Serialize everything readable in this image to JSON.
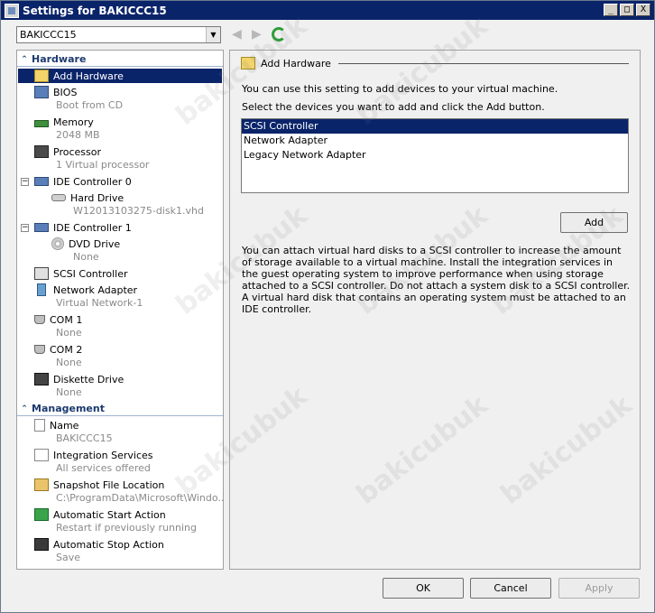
{
  "window": {
    "title": "Settings for BAKICCC15",
    "minimize": "_",
    "maximize": "□",
    "close": "X"
  },
  "vm_select": {
    "value": "BAKICCC15"
  },
  "left": {
    "hardware_header": "Hardware",
    "management_header": "Management",
    "items": {
      "add_hardware": "Add Hardware",
      "bios": "BIOS",
      "bios_sub": "Boot from CD",
      "memory": "Memory",
      "memory_sub": "2048 MB",
      "processor": "Processor",
      "processor_sub": "1 Virtual processor",
      "ide0": "IDE Controller 0",
      "hard_drive": "Hard Drive",
      "hard_drive_sub": "W12013103275-disk1.vhd",
      "ide1": "IDE Controller 1",
      "dvd_drive": "DVD Drive",
      "dvd_drive_sub": "None",
      "scsi": "SCSI Controller",
      "network": "Network Adapter",
      "network_sub": "Virtual Network-1",
      "com1": "COM 1",
      "com1_sub": "None",
      "com2": "COM 2",
      "com2_sub": "None",
      "diskette": "Diskette Drive",
      "diskette_sub": "None",
      "name": "Name",
      "name_sub": "BAKICCC15",
      "integration": "Integration Services",
      "integration_sub": "All services offered",
      "snapshot": "Snapshot File Location",
      "snapshot_sub": "C:\\ProgramData\\Microsoft\\Windo...",
      "auto_start": "Automatic Start Action",
      "auto_start_sub": "Restart if previously running",
      "auto_stop": "Automatic Stop Action",
      "auto_stop_sub": "Save"
    }
  },
  "right": {
    "header": "Add Hardware",
    "intro": "You can use this setting to add devices to your virtual machine.",
    "select_prompt": "Select the devices you want to add and click the Add button.",
    "devices": [
      "SCSI Controller",
      "Network Adapter",
      "Legacy Network Adapter"
    ],
    "add_button": "Add",
    "description": "You can attach virtual hard disks to a SCSI controller to increase the amount of storage available to a virtual machine. Install the integration services in the guest operating system to improve performance when using storage attached to a SCSI controller. Do not attach a system disk to a SCSI controller. A virtual hard disk that contains an operating system must be attached to an IDE controller."
  },
  "footer": {
    "ok": "OK",
    "cancel": "Cancel",
    "apply": "Apply"
  },
  "watermark": "bakicubuk"
}
